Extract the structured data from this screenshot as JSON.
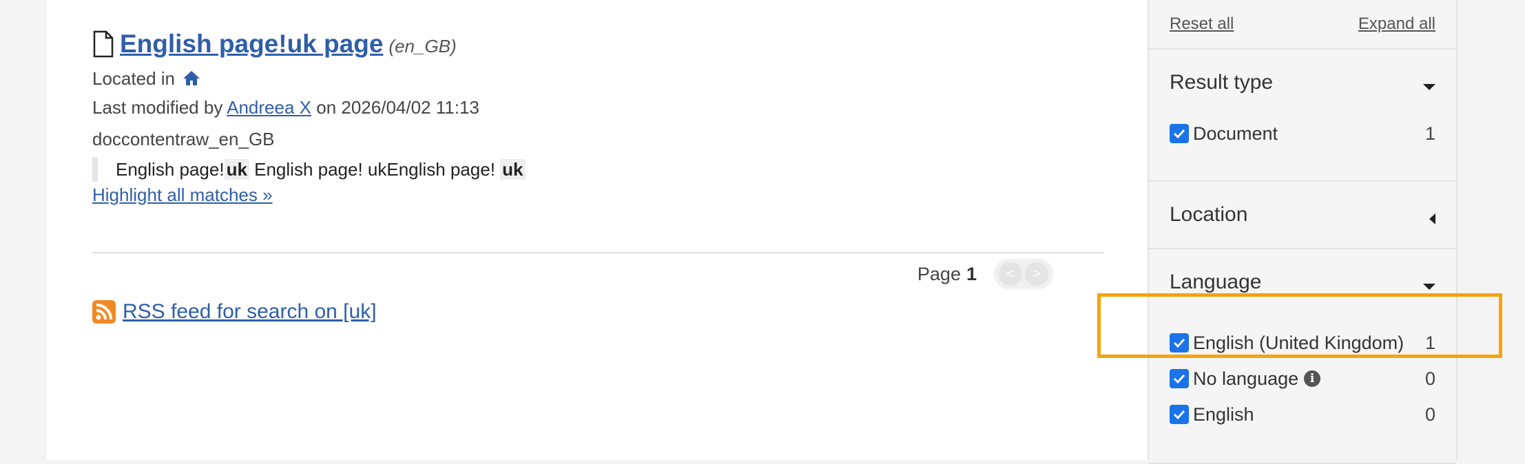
{
  "result": {
    "title": "English page!uk page",
    "lang": "(en_GB)",
    "located_in": "Located in",
    "modified_prefix": "Last modified by",
    "modified_user": "Andreea X",
    "modified_suffix": "on 2026/04/02 11:13",
    "raw_field": "doccontentraw_en_GB",
    "snippet": {
      "part1": "English page!",
      "hl1": "uk",
      "part2": " English page! ukEnglish page! ",
      "hl2": "uk"
    },
    "highlight_link": "Highlight all matches »"
  },
  "pager": {
    "label": "Page",
    "current": "1",
    "prev_icon": "<",
    "next_icon": ">"
  },
  "rss": {
    "link": "RSS feed for search on [uk]",
    "icon": "rss-icon"
  },
  "sidebar": {
    "reset": "Reset all",
    "expand": "Expand all",
    "facets": [
      {
        "title": "Result type",
        "expanded": true,
        "items": [
          {
            "label": "Document",
            "count": "1",
            "checked": true
          }
        ]
      },
      {
        "title": "Location",
        "expanded": false,
        "items": []
      },
      {
        "title": "Language",
        "expanded": true,
        "items": [
          {
            "label": "English (United Kingdom)",
            "count": "1",
            "checked": true
          },
          {
            "label": "No language",
            "count": "0",
            "checked": true
          },
          {
            "label": "English",
            "count": "0",
            "checked": true
          }
        ]
      }
    ]
  },
  "colors": {
    "link": "#2f5ea8",
    "checkbox": "#1a73e8",
    "highlight_box": "#f5a40c"
  }
}
